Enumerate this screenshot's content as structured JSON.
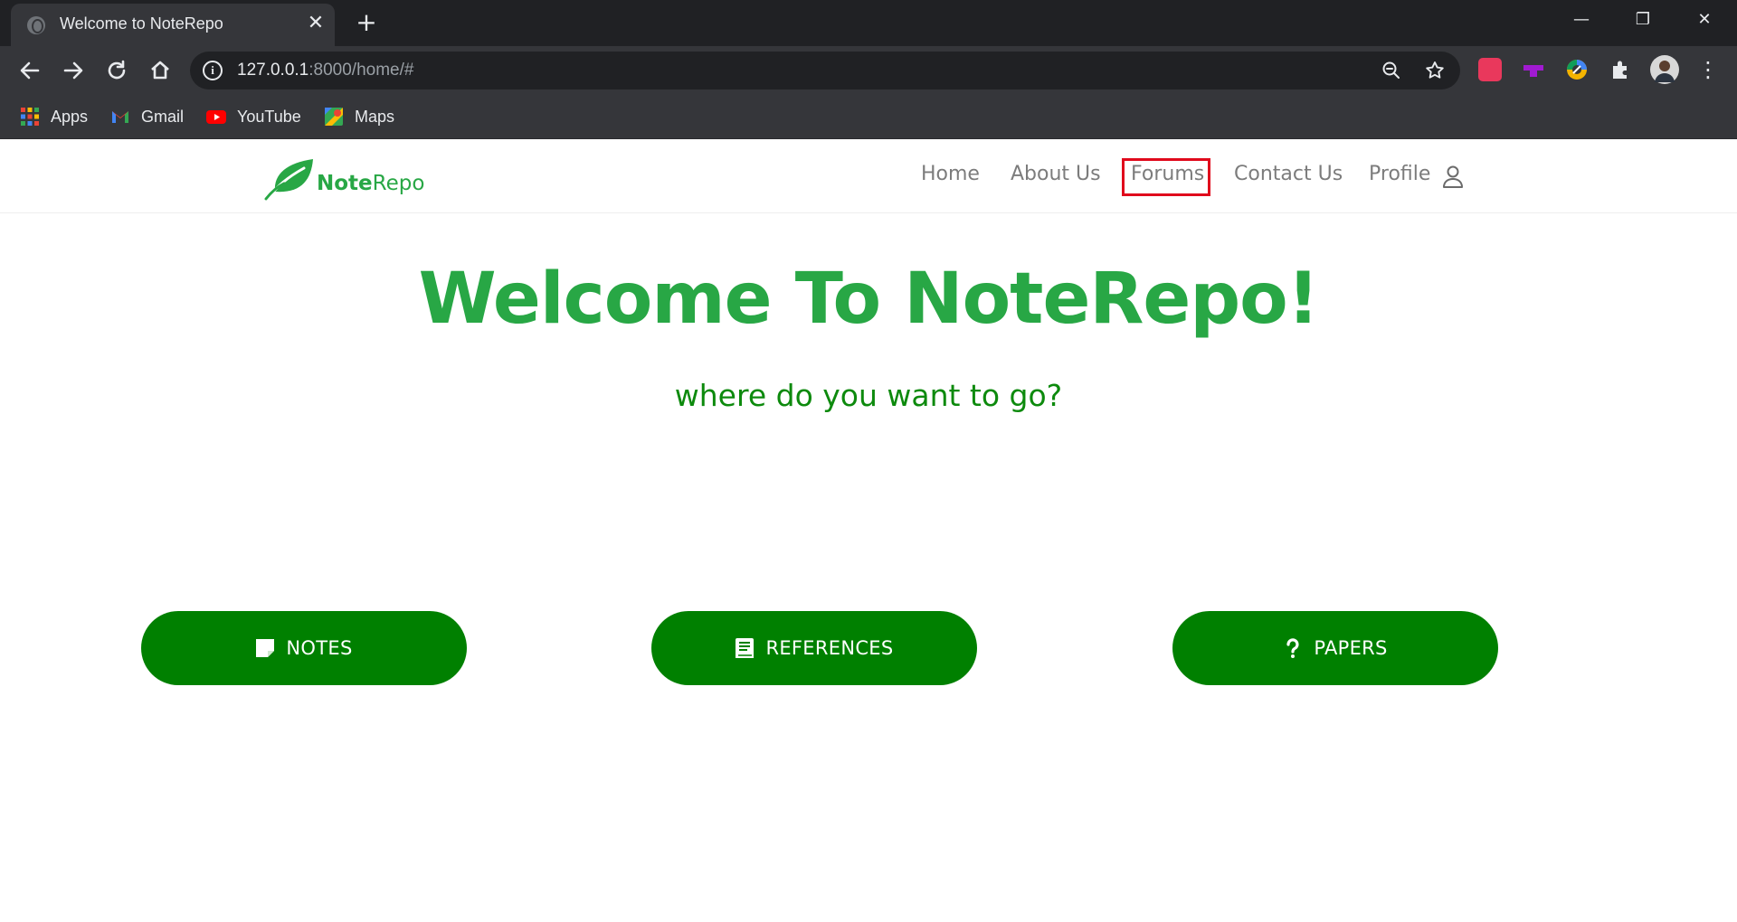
{
  "browser": {
    "tab_title": "Welcome to NoteRepo",
    "new_tab_symbol": "+",
    "close_symbol": "✕",
    "url_host": "127.0.0.1",
    "url_rest": ":8000/home/#",
    "bookmarks": [
      {
        "label": "Apps",
        "icon": "apps-grid-icon"
      },
      {
        "label": "Gmail",
        "icon": "gmail-icon"
      },
      {
        "label": "YouTube",
        "icon": "youtube-icon"
      },
      {
        "label": "Maps",
        "icon": "maps-icon"
      }
    ],
    "window_controls": {
      "minimize": "—",
      "restore": "❐",
      "close": "✕"
    }
  },
  "site": {
    "logo": {
      "bold": "Note",
      "regular": "Repo"
    },
    "nav": {
      "home": "Home",
      "about": "About Us",
      "forums": "Forums",
      "contact": "Contact Us",
      "profile": "Profile"
    },
    "highlighted_nav_item": "Forums",
    "hero": {
      "title_prefix": "Welcome To ",
      "title_bold": "Note",
      "title_suffix": "Repo!",
      "subtitle": "where do you want to go?"
    },
    "buttons": {
      "notes": "NOTES",
      "references": "REFERENCES",
      "papers": "PAPERS"
    }
  },
  "colors": {
    "brand_green": "#28a745",
    "button_green": "#008000",
    "subtitle_green": "#0d8a0d",
    "highlight_red": "#e00a1c",
    "chrome_dark": "#202124",
    "chrome_toolbar": "#35363a"
  }
}
